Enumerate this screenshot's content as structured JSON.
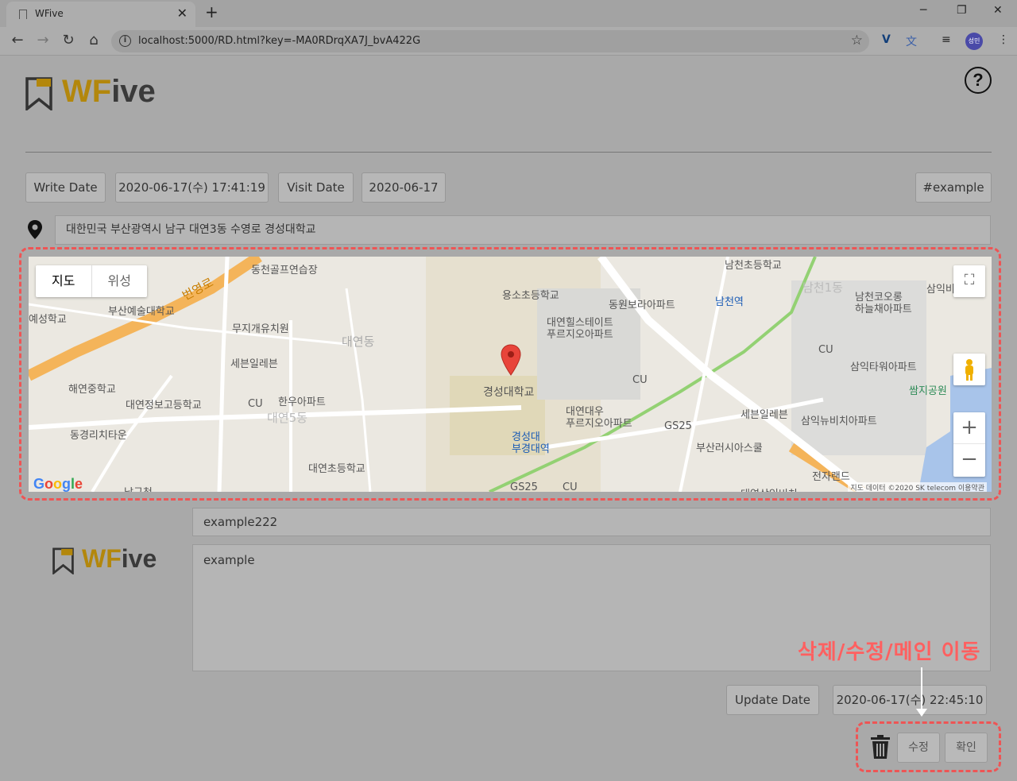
{
  "browser": {
    "tab_title": "WFive",
    "url": "localhost:5000/RD.html?key=-MA0RDrqXA7J_bvA422G",
    "profile_label": "성민"
  },
  "logo": {
    "first_letters": "WF",
    "rest": "ive"
  },
  "header": {
    "help_label": "?"
  },
  "meta": {
    "write_date_label": "Write Date",
    "write_date_value": "2020-06-17(수) 17:41:19",
    "visit_date_label": "Visit Date",
    "visit_date_value": "2020-06-17",
    "tag": "#example"
  },
  "location": {
    "address": "대한민국 부산광역시 남구 대연3동 수영로 경성대학교"
  },
  "map": {
    "type_map": "지도",
    "type_satellite": "위성",
    "zoom_in": "+",
    "zoom_out": "−",
    "attribution": "지도 데이터 ©2020 SK telecom   이용약관",
    "labels": {
      "l1": "동천골프연습장",
      "l2": "부산예술대학교",
      "l3": "예성학교",
      "l4": "무지개유치원",
      "l5": "대연동",
      "l6": "세븐일레븐",
      "l7": "해연중학교",
      "l8": "대연정보고등학교",
      "l9": "CU",
      "l10": "한우아파트",
      "l11": "대연5동",
      "l12": "동경리치타운",
      "l13": "대연초등학교",
      "l14": "용소초등학교",
      "l15": "동원보라아파트",
      "l16": "대연힐스테이트\n푸르지오아파트",
      "l17": "경성대학교",
      "l18": "CU",
      "l19": "대연대우\n푸르지오아파트",
      "l20": "GS25",
      "l21": "경성대\n부경대역",
      "l22": "GS25",
      "l23": "CU",
      "l24": "남천초등학교",
      "l25": "남천역",
      "l26": "남천1동",
      "l27": "남천코오롱\n하늘채아파트",
      "l28": "CU",
      "l29": "삼익타워아파트",
      "l30": "쌈지공원",
      "l31": "세븐일레븐",
      "l32": "삼익뉴비치아파트",
      "l33": "부산러시아스쿨",
      "l34": "전자랜드",
      "l35": "번영로",
      "l36": "삼익비",
      "l37": "남구청",
      "l38": "대연삼익비치"
    },
    "google": "Google"
  },
  "post": {
    "title": "example222",
    "body": "example",
    "update_date_label": "Update Date",
    "update_date_value": "2020-06-17(수) 22:45:10"
  },
  "annotation": "삭제/수정/메인 이동",
  "actions": {
    "edit_label": "수정",
    "confirm_label": "확인"
  }
}
